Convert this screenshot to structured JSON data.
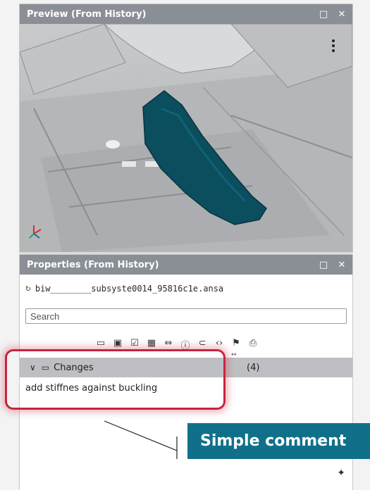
{
  "preview_panel": {
    "title": "Preview (From History)",
    "maximize_icon": "□",
    "close_icon": "✕"
  },
  "properties_panel": {
    "title": "Properties (From History)",
    "maximize_icon": "□",
    "close_icon": "✕",
    "file_name": "biw________subsyste0014_95816c1e.ansa",
    "search_placeholder": "Search",
    "toolbar_icons": [
      "comment-icon",
      "image-icon",
      "checkbox-icon",
      "grid-icon",
      "compare-icon",
      "info-icon",
      "attachment-icon",
      "code-icon",
      "flag-icon",
      "print-icon"
    ],
    "split_handle": "↔",
    "changes": {
      "label": "Changes",
      "count": "(4)",
      "items": [
        "add stiffnes against buckling"
      ]
    },
    "sparkle_icon": "✦"
  },
  "callout": {
    "text": "Simple comment"
  },
  "colors": {
    "titlebar": "#8a8f96",
    "part_highlight": "#0b4e5e",
    "annotation_red": "#c8243d",
    "callout_bg": "#10708a"
  }
}
